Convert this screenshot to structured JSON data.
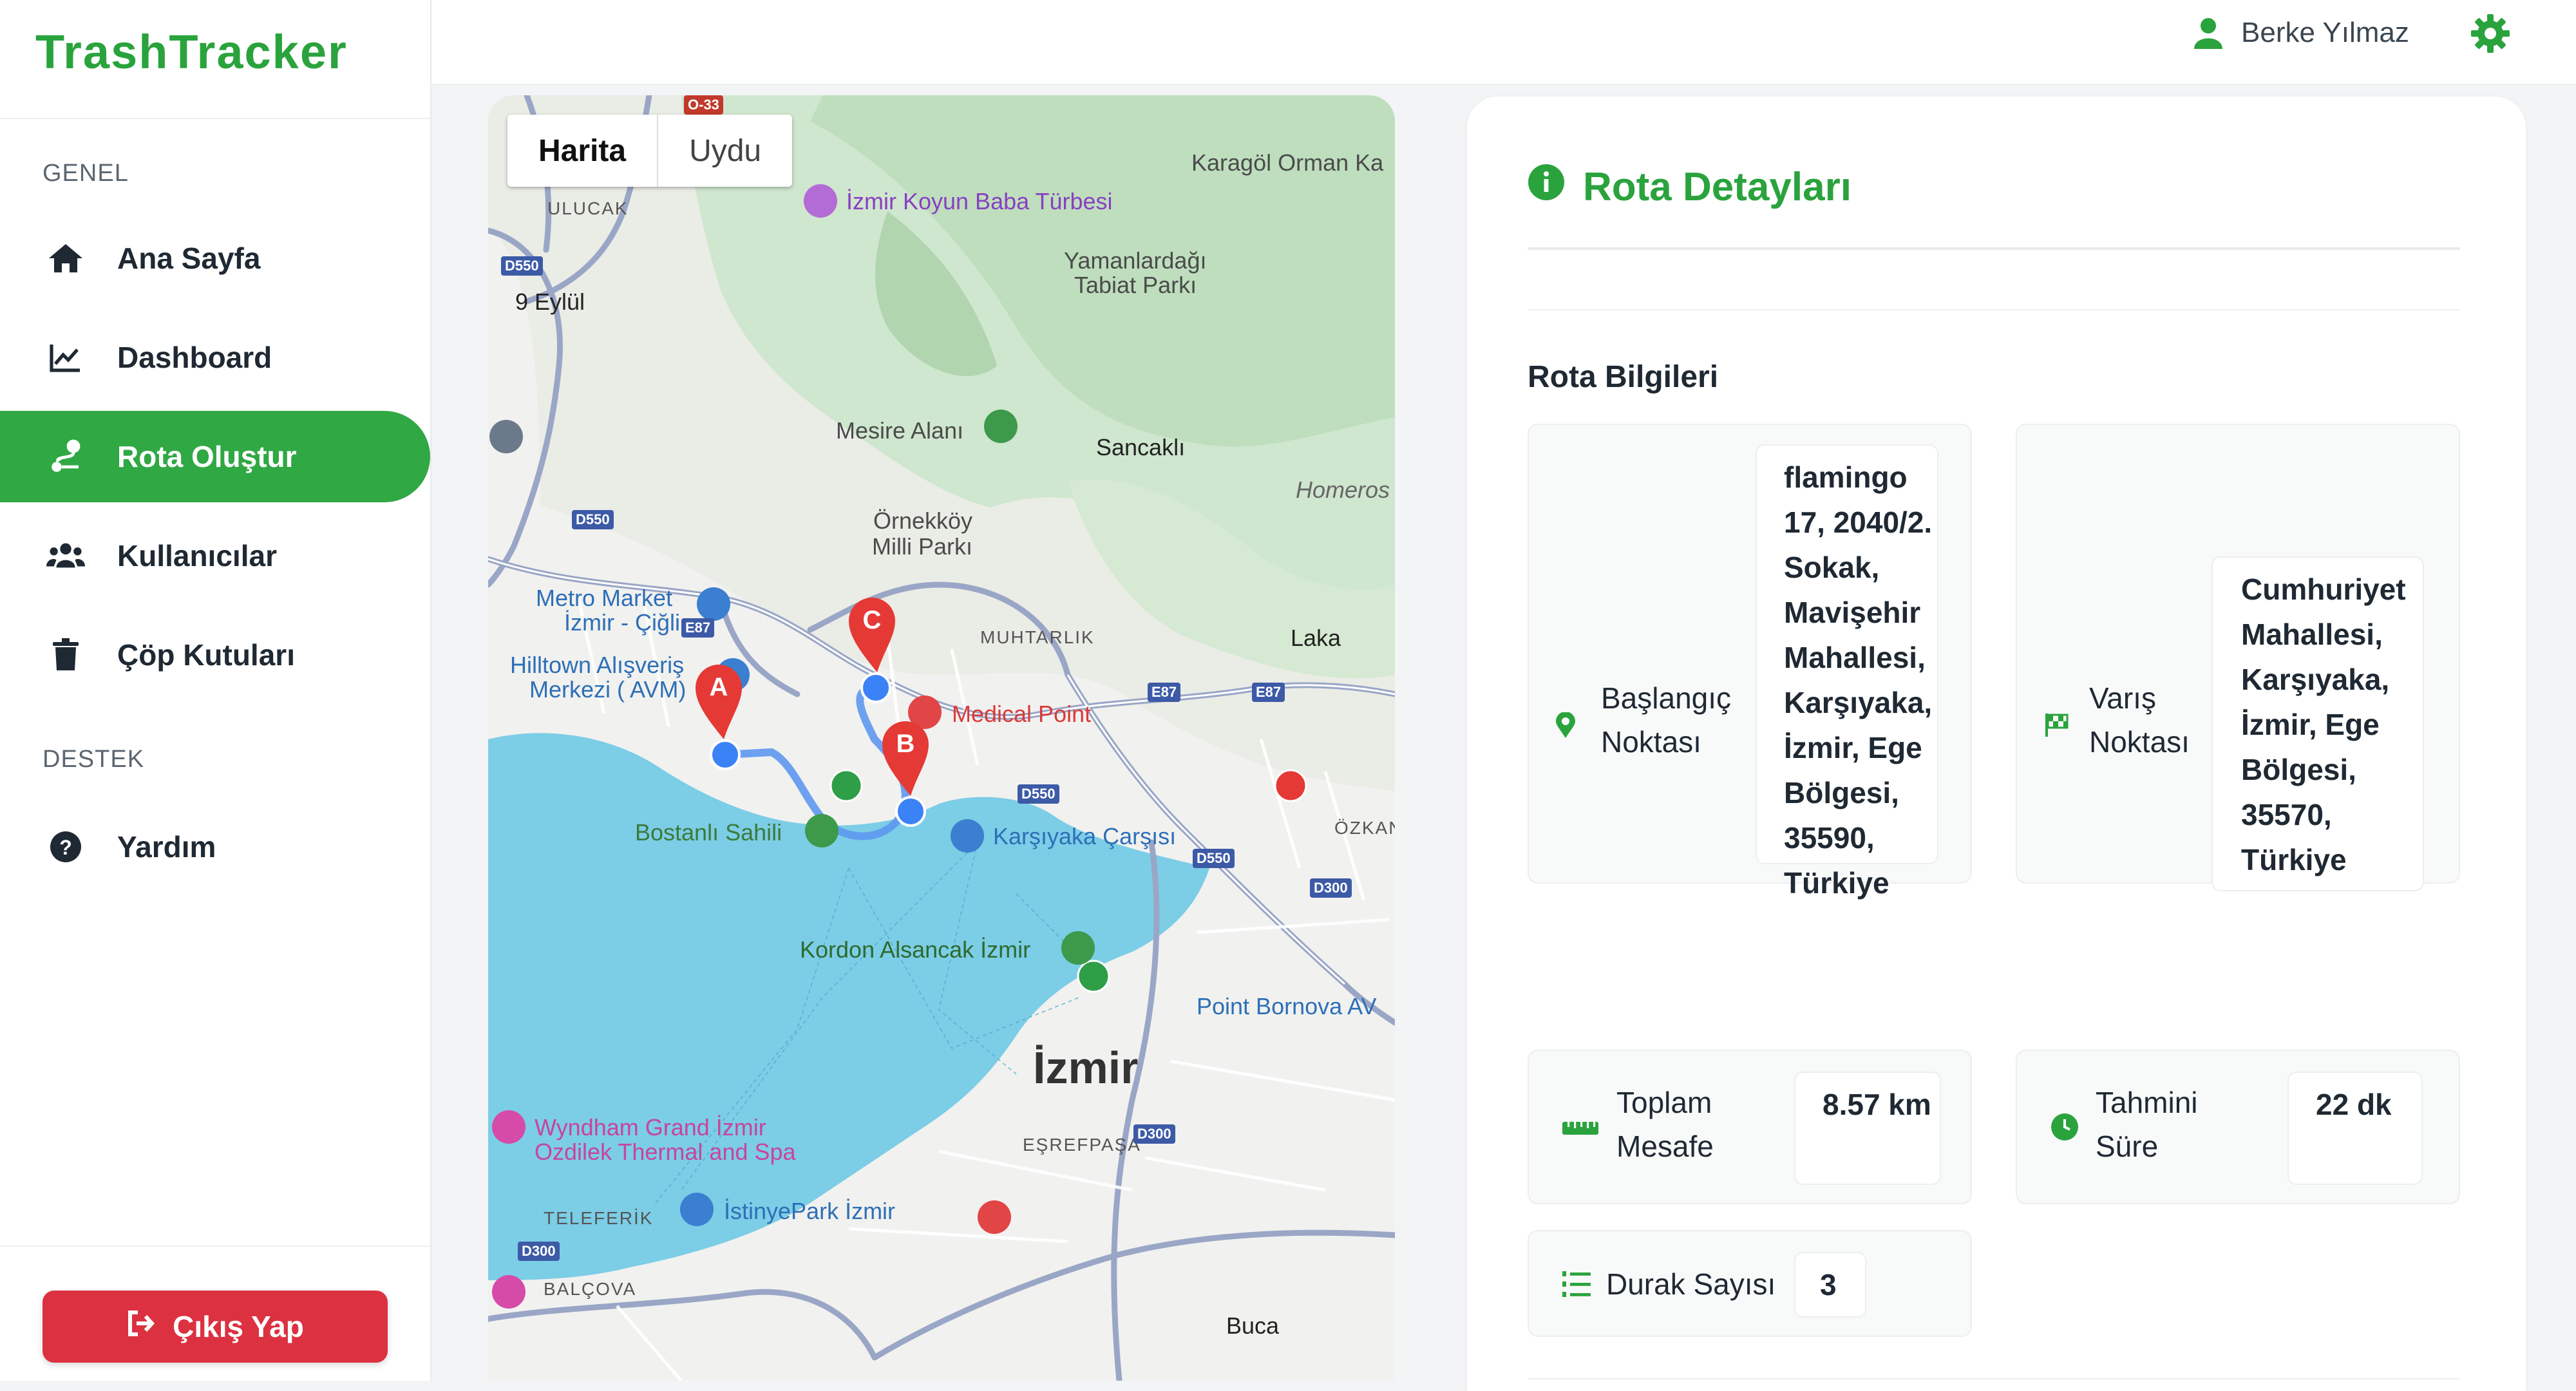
{
  "app": {
    "brand": "TrashTracker"
  },
  "sidebar": {
    "section_general": "GENEL",
    "section_support": "DESTEK",
    "items": [
      {
        "label": "Ana Sayfa",
        "icon": "home-icon"
      },
      {
        "label": "Dashboard",
        "icon": "chart-line-icon"
      },
      {
        "label": "Rota Oluştur",
        "icon": "route-icon",
        "active": true
      },
      {
        "label": "Kullanıcılar",
        "icon": "users-icon"
      },
      {
        "label": "Çöp Kutuları",
        "icon": "trash-icon"
      }
    ],
    "support_items": [
      {
        "label": "Yardım",
        "icon": "help-icon"
      }
    ],
    "logout_label": "Çıkış Yap"
  },
  "header": {
    "user_name": "Berke Yılmaz"
  },
  "map": {
    "toggle": {
      "map_label": "Harita",
      "satellite_label": "Uydu"
    },
    "labels": {
      "karagol": "Karagöl Orman Ka",
      "koyun_baba": "İzmir Koyun Baba Türbesi",
      "ulucak": "ULUCAK",
      "yamanlar": "Yamanlardağı",
      "tabiat": "Tabiat Parkı",
      "dokuz_eylul": "9 Eylül",
      "mesire": "Mesire Alanı",
      "sancakli": "Sancaklı",
      "homeros": "Homeros",
      "ornekkoy": "Örnekköy",
      "milli_parki": "Milli Parkı",
      "metro1": "Metro Market",
      "metro2": "İzmir - Çiğli",
      "muhtarlik": "MUHTARLIK",
      "laka": "Laka",
      "hilltown1": "Hilltown Alışveriş",
      "hilltown2": "Merkezi ( AVM)",
      "medical": "Medical Point",
      "bostanli": "Bostanlı Sahili",
      "karsiyaka_carsi": "Karşıyaka Çarşısı",
      "ozkan": "ÖZKAN",
      "kordon": "Kordon Alsancak İzmir",
      "point_bornova": "Point Bornova AV",
      "izmir": "İzmir",
      "wyndham1": "Wyndham Grand İzmir",
      "wyndham2": "Ozdilek Thermal and Spa",
      "esrefpasa": "EŞREFPAŞA",
      "teleferik": "TELEFERİK",
      "istinye": "İstinyePark İzmir",
      "balcova": "BALÇOVA",
      "buca": "Buca",
      "road_e87": "E87",
      "road_d550": "D550",
      "road_d300": "D300",
      "road_o33": "O-33"
    },
    "markers": [
      {
        "letter": "A",
        "color": "#e53935"
      },
      {
        "letter": "B",
        "color": "#e53935"
      },
      {
        "letter": "C",
        "color": "#e53935"
      }
    ]
  },
  "route_details": {
    "title": "Rota Detayları",
    "section": "Rota Bilgileri",
    "start_label": "Başlangıç Noktası",
    "start_value": "flamingo 17, 2040/2. Sokak, Mavişehir Mahallesi, Karşıyaka, İzmir, Ege Bölgesi, 35590, Türkiye",
    "end_label": "Varış Noktası",
    "end_value": "Cumhuriyet Mahallesi, Karşıyaka, İzmir, Ege Bölgesi, 35570, Türkiye",
    "distance_label": "Toplam Mesafe",
    "distance_value": "8.57 km",
    "duration_label": "Tahmini Süre",
    "duration_value": "22 dk",
    "stops_label": "Durak Sayısı",
    "stops_value": "3"
  },
  "colors": {
    "brand_green": "#2aa33d",
    "active_nav": "#30a844",
    "logout_red": "#dc3141",
    "water": "#7ccde6",
    "route_blue": "#3b82f6"
  }
}
